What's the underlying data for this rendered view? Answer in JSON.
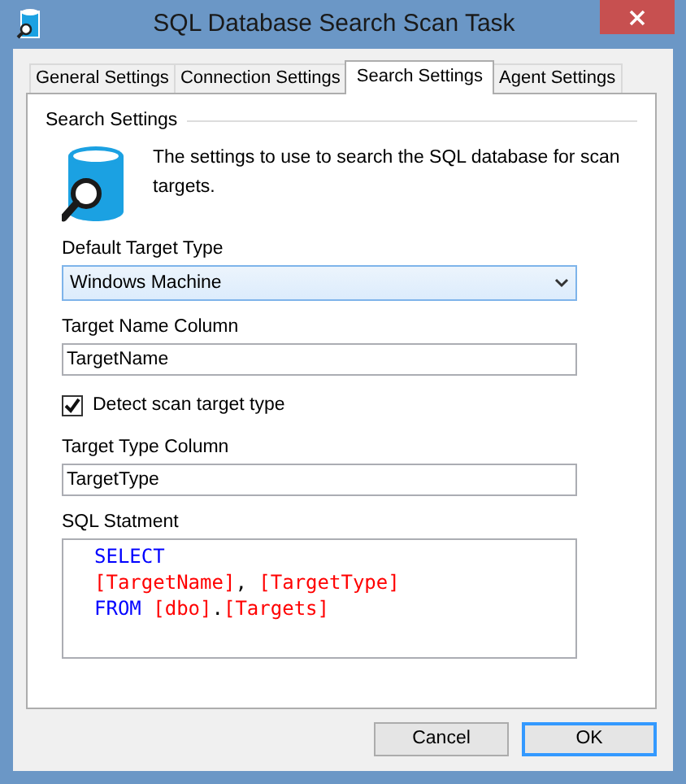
{
  "window": {
    "title": "SQL Database Search Scan Task"
  },
  "tabs": [
    {
      "label": "General Settings",
      "selected": false
    },
    {
      "label": "Connection Settings",
      "selected": false
    },
    {
      "label": "Search Settings",
      "selected": true
    },
    {
      "label": "Agent Settings",
      "selected": false
    }
  ],
  "group": {
    "title": "Search Settings",
    "description": "The settings to use to search the SQL database for scan targets."
  },
  "fields": [
    {
      "kind": "dropdown",
      "label": "Default Target Type",
      "value": "Windows Machine"
    },
    {
      "kind": "text",
      "label": "Target Name Column",
      "value": "TargetName"
    },
    {
      "kind": "checkbox",
      "label": "Detect scan target type",
      "checked": true
    },
    {
      "kind": "text",
      "label": "Target Type Column",
      "value": "TargetType"
    },
    {
      "kind": "code",
      "label": "SQL Statment",
      "lines": [
        [
          {
            "kind": "keyword",
            "text": "SELECT"
          }
        ],
        [
          {
            "kind": "identifier",
            "text": "[TargetName]"
          },
          {
            "kind": "plain",
            "text": ", "
          },
          {
            "kind": "identifier",
            "text": "[TargetType]"
          }
        ],
        [
          {
            "kind": "keyword",
            "text": "FROM "
          },
          {
            "kind": "identifier",
            "text": "[dbo]"
          },
          {
            "kind": "plain",
            "text": "."
          },
          {
            "kind": "identifier",
            "text": "[Targets]"
          }
        ]
      ]
    }
  ],
  "buttons": [
    {
      "label": "Cancel",
      "default": false
    },
    {
      "label": "OK",
      "default": true
    }
  ]
}
